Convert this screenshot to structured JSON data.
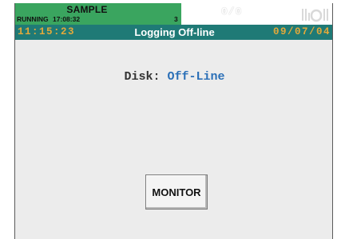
{
  "status": {
    "batch_name": "SAMPLE",
    "run_state": "RUNNING",
    "run_time": "17:08:32",
    "group_number": "3",
    "alarm_count": "0/0",
    "disk_icon": "disk-activity-icon"
  },
  "title_bar": {
    "time": "11:15:23",
    "title": "Logging Off-line",
    "date": "09/07/04"
  },
  "main": {
    "disk_label": "Disk:",
    "disk_status": "Off-Line"
  },
  "buttons": {
    "monitor_label": "MONITOR"
  },
  "colors": {
    "status_green": "#3aa55f",
    "title_teal": "#1f7a76",
    "time_orange": "#e3a93a",
    "disk_status_blue": "#2a6fb7"
  }
}
